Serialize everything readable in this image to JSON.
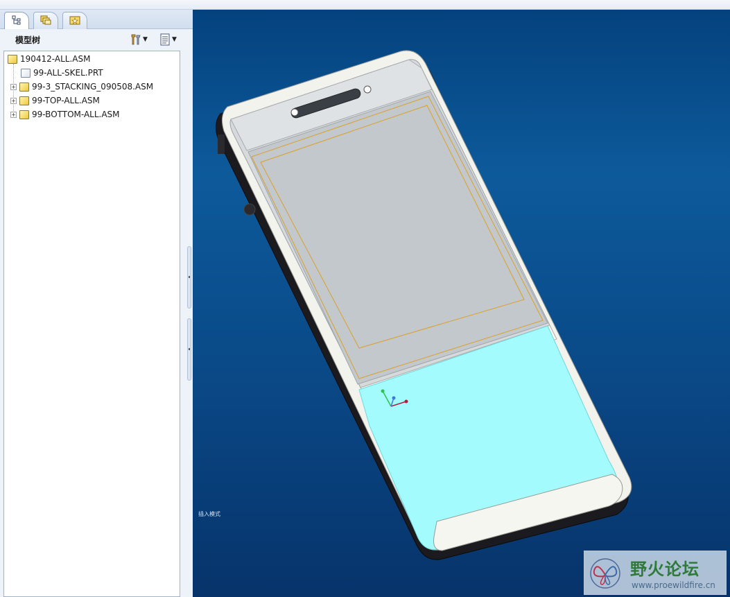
{
  "menubar": {
    "partial_text": ""
  },
  "left_panel": {
    "tabs": [
      {
        "icon": "model-tree-icon",
        "active": true
      },
      {
        "icon": "folder-browser-icon",
        "active": false
      },
      {
        "icon": "favorites-icon",
        "active": false
      }
    ],
    "tree_title": "模型树",
    "header_buttons": [
      {
        "icon": "settings-tools-icon",
        "has_dropdown": true
      },
      {
        "icon": "show-options-icon",
        "has_dropdown": true
      }
    ],
    "tree_items": [
      {
        "label": "190412-ALL.ASM",
        "type": "assembly",
        "level": 0,
        "expandable": false
      },
      {
        "label": "99-ALL-SKEL.PRT",
        "type": "part",
        "level": 1,
        "expandable": false
      },
      {
        "label": "99-3_STACKING_090508.ASM",
        "type": "assembly",
        "level": 1,
        "expandable": true
      },
      {
        "label": "99-TOP-ALL.ASM",
        "type": "assembly",
        "level": 1,
        "expandable": true
      },
      {
        "label": "99-BOTTOM-ALL.ASM",
        "type": "assembly",
        "level": 1,
        "expandable": true
      }
    ]
  },
  "viewport": {
    "mode_label": "插入模式",
    "colors": {
      "background_top": "#04427e",
      "background_bottom": "#07336a",
      "body_shell": "#f3f3ee",
      "screen_gray": "#c3c8cc",
      "lower_cover": "#a4fbfe",
      "outline_orange": "#d9a02a"
    }
  },
  "watermark": {
    "title": "野火论坛",
    "url": "www.proewildfire.cn",
    "icon": "butterfly-logo-icon"
  }
}
